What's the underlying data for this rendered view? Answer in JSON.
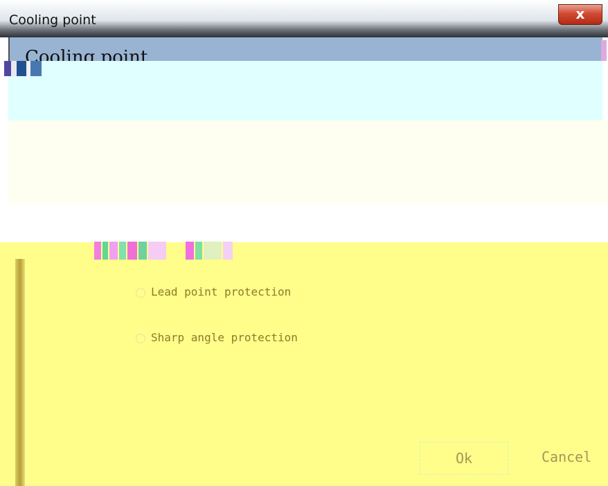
{
  "window": {
    "title": "Cooling point",
    "close_symbol": "x"
  },
  "header": {
    "title": "Cooling point"
  },
  "options": [
    {
      "label": "Lead point protection",
      "icon": "radio-icon"
    },
    {
      "label": "Sharp angle protection",
      "icon": "radio-icon"
    }
  ],
  "buttons": {
    "ok_label": "Ok",
    "cancel_label": "Cancel"
  },
  "colors": {
    "header_bg": "#98b4d2",
    "panel_yellow": "#fffe8a",
    "text_olive": "#8c7b2a"
  }
}
